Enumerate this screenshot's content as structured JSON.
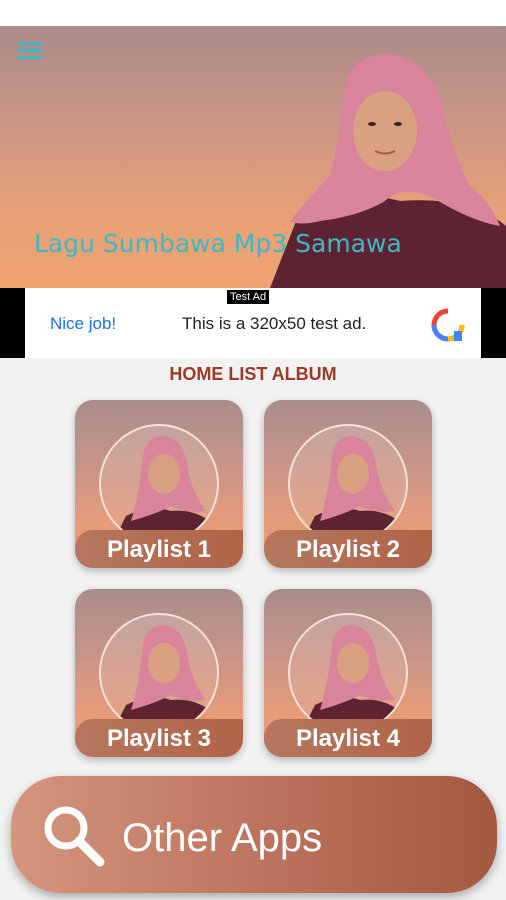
{
  "header": {
    "title": "Lagu Sumbawa Mp3 Samawa",
    "menu_icon": "hamburger-icon"
  },
  "ad": {
    "tag": "Test Ad",
    "nice": "Nice job!",
    "text": "This is a 320x50 test ad."
  },
  "section_title": "HOME LIST ALBUM",
  "playlists": [
    {
      "label": "Playlist 1"
    },
    {
      "label": "Playlist 2"
    },
    {
      "label": "Playlist 3"
    },
    {
      "label": "Playlist 4"
    }
  ],
  "other_apps": {
    "label": "Other Apps",
    "icon": "search-icon"
  },
  "colors": {
    "accent_title": "#3bb9c6",
    "section_title": "#9c3a25",
    "button": "#b86e58"
  }
}
